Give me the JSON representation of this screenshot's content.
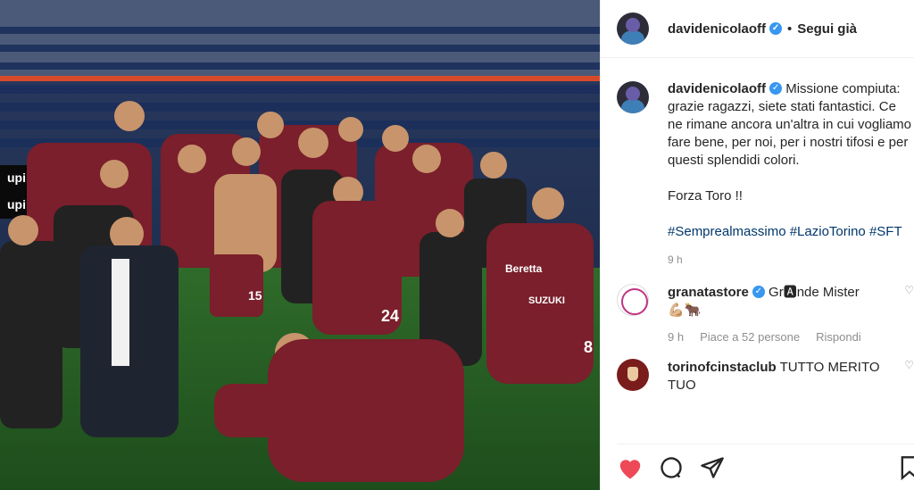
{
  "post": {
    "username": "davidenicolaoff",
    "follow_state": "Segui già",
    "caption_lines": [
      "Missione compiuta: grazie ragazzi, siete stati fantastici. Ce ne rimane ancora un'altra in cui vogliamo fare bene, per noi, per i nostri tifosi e per questi splendidi colori."
    ],
    "caption_second": "Forza Toro !!",
    "hashtags": "#Semprealmassimo #LazioTorino #SFT",
    "time": "9 h"
  },
  "comments": [
    {
      "username": "granatastore",
      "text": "Gr🅰nde Mister",
      "emoji": "💪🏼🐂",
      "time": "9 h",
      "likes": "Piace a 52 persone",
      "reply": "Rispondi"
    },
    {
      "username": "torinofcinstaclub",
      "text": "TUTTO MERITO TUO"
    }
  ],
  "photo": {
    "banner_left": "upim",
    "banner_left2": "upim",
    "jersey_sponsor": "SUZUKI",
    "jersey_brand": "Beretta",
    "jersey_numbers": [
      "15",
      "24",
      "8"
    ]
  },
  "icons": {
    "like": "heart-icon",
    "comment": "comment-icon",
    "share": "share-icon",
    "save": "bookmark-icon"
  },
  "colors": {
    "verified": "#3897f0",
    "heart": "#ed4956",
    "hashtag": "#00376b",
    "jersey": "#7a1f2b"
  }
}
